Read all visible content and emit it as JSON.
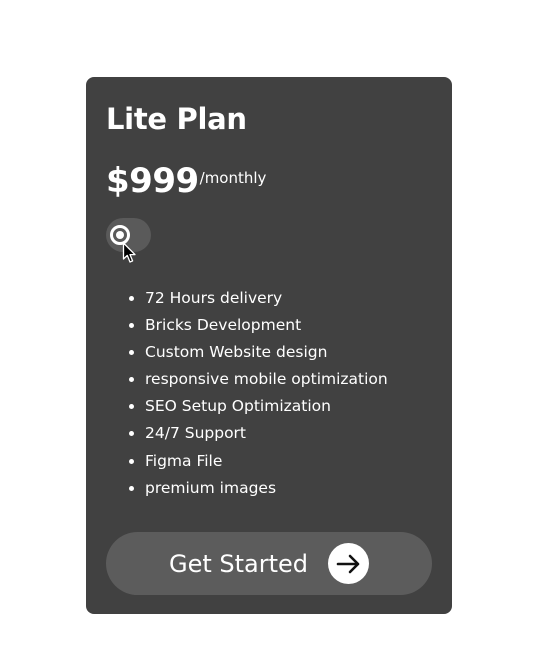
{
  "plan": {
    "title": "Lite Plan",
    "price": "$999",
    "period": "/monthly"
  },
  "toggle": {
    "state": "off"
  },
  "features": [
    "72 Hours delivery",
    "Bricks Development",
    "Custom Website design",
    "responsive mobile optimization",
    "SEO Setup Optimization",
    "24/7 Support",
    "Figma File",
    "premium images"
  ],
  "cta": {
    "label": "Get Started",
    "icon": "arrow-right-icon"
  },
  "colors": {
    "page_background": "#ffffff",
    "card_background": "#414141",
    "button_background": "#5c5c5c",
    "text": "#ffffff"
  }
}
